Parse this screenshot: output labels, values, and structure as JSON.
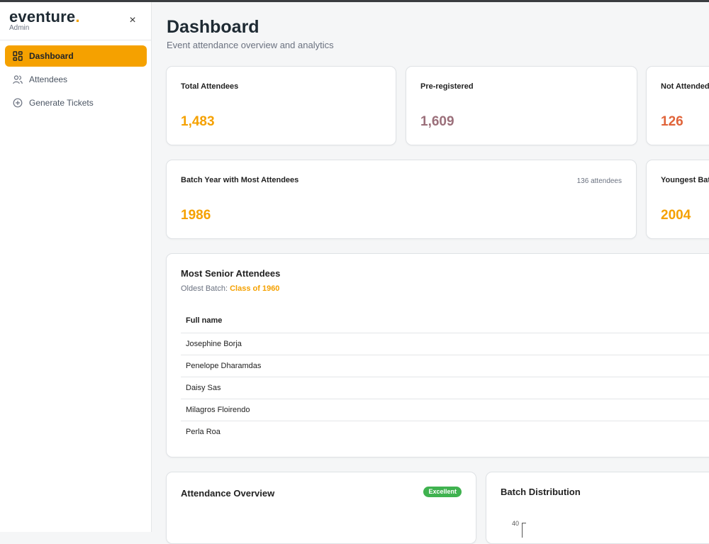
{
  "sidebar": {
    "brand": "eventure",
    "brand_dot": ".",
    "role": "Admin",
    "close": "×",
    "items": [
      {
        "label": "Dashboard",
        "icon": "dashboard-grid-icon",
        "active": true
      },
      {
        "label": "Attendees",
        "icon": "users-icon",
        "active": false
      },
      {
        "label": "Generate Tickets",
        "icon": "plus-circle-icon",
        "active": false
      }
    ]
  },
  "header": {
    "title": "Dashboard",
    "subtitle": "Event attendance overview and analytics"
  },
  "stats": {
    "total_attendees": {
      "label": "Total Attendees",
      "value": "1,483"
    },
    "pre_registered": {
      "label": "Pre-registered",
      "value": "1,609"
    },
    "not_attended": {
      "label": "Not Attended",
      "value": "126"
    }
  },
  "batch": {
    "most_attendees": {
      "label": "Batch Year with Most Attendees",
      "value": "1986",
      "note": "136 attendees"
    },
    "youngest": {
      "label": "Youngest Batch",
      "value": "2004"
    }
  },
  "senior": {
    "title": "Most Senior Attendees",
    "oldest_label": "Oldest Batch:",
    "oldest_value": "Class of 1960",
    "column": "Full name",
    "rows": [
      "Josephine Borja",
      "Penelope Dharamdas",
      "Daisy Sas",
      "Milagros Floirendo",
      "Perla Roa"
    ]
  },
  "overview": {
    "title": "Attendance Overview",
    "badge": "Excellent"
  },
  "distribution": {
    "title": "Batch Distribution",
    "tick_top": "40"
  },
  "colors": {
    "accent": "#f5a100",
    "mauve": "#9b6f7a",
    "danger": "#e0643a",
    "success": "#3fb24f"
  }
}
